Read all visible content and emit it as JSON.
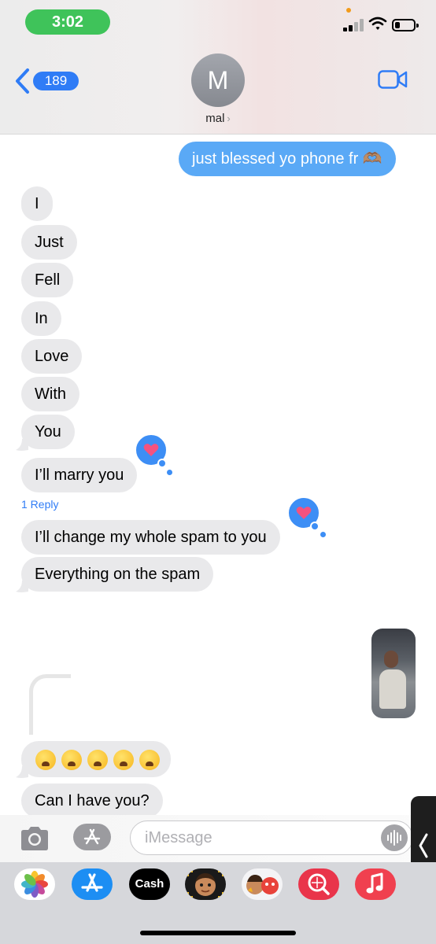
{
  "status_bar": {
    "time": "3:02"
  },
  "header": {
    "back_count": "189",
    "avatar_initial": "M",
    "contact_name": "mal",
    "contact_chevron": "›"
  },
  "messages": [
    {
      "direction": "outgoing",
      "text": "just blessed yo phone fr 🫶🏽"
    },
    {
      "direction": "incoming",
      "text": "I"
    },
    {
      "direction": "incoming",
      "text": "Just"
    },
    {
      "direction": "incoming",
      "text": "Fell"
    },
    {
      "direction": "incoming",
      "text": "In"
    },
    {
      "direction": "incoming",
      "text": "Love"
    },
    {
      "direction": "incoming",
      "text": "With"
    },
    {
      "direction": "incoming",
      "text": "You"
    },
    {
      "direction": "incoming",
      "text": "I’ll marry you",
      "tapback": "heart"
    },
    {
      "direction": "incoming",
      "text": "I’ll change my whole spam to you",
      "tapback": "heart"
    },
    {
      "direction": "incoming",
      "text": "Everything on the spam"
    },
    {
      "direction": "outgoing",
      "type": "photo"
    },
    {
      "direction": "incoming",
      "text": "😩😩😩😩😩",
      "emoji_count": 5
    },
    {
      "direction": "incoming",
      "text": "Can I have you?"
    }
  ],
  "reply_link": "1 Reply",
  "input_bar": {
    "placeholder": "iMessage"
  },
  "app_drawer": [
    {
      "name": "Photos",
      "icon": "photos-icon"
    },
    {
      "name": "App Store",
      "icon": "appstore-icon"
    },
    {
      "name": "Cash",
      "label": "Cash",
      "icon": "apple-cash-icon"
    },
    {
      "name": "Memoji",
      "icon": "memoji-icon"
    },
    {
      "name": "Memoji Stickers",
      "icon": "memoji-stickers-icon"
    },
    {
      "name": "Images",
      "icon": "web-images-icon"
    },
    {
      "name": "Music",
      "icon": "music-icon"
    }
  ],
  "colors": {
    "outgoing_bubble": "#5aa9f6",
    "incoming_bubble": "#e9e9eb",
    "accent": "#2f7cf6",
    "tapback": "#3d8ef5",
    "time_pill": "#3fc35a"
  }
}
